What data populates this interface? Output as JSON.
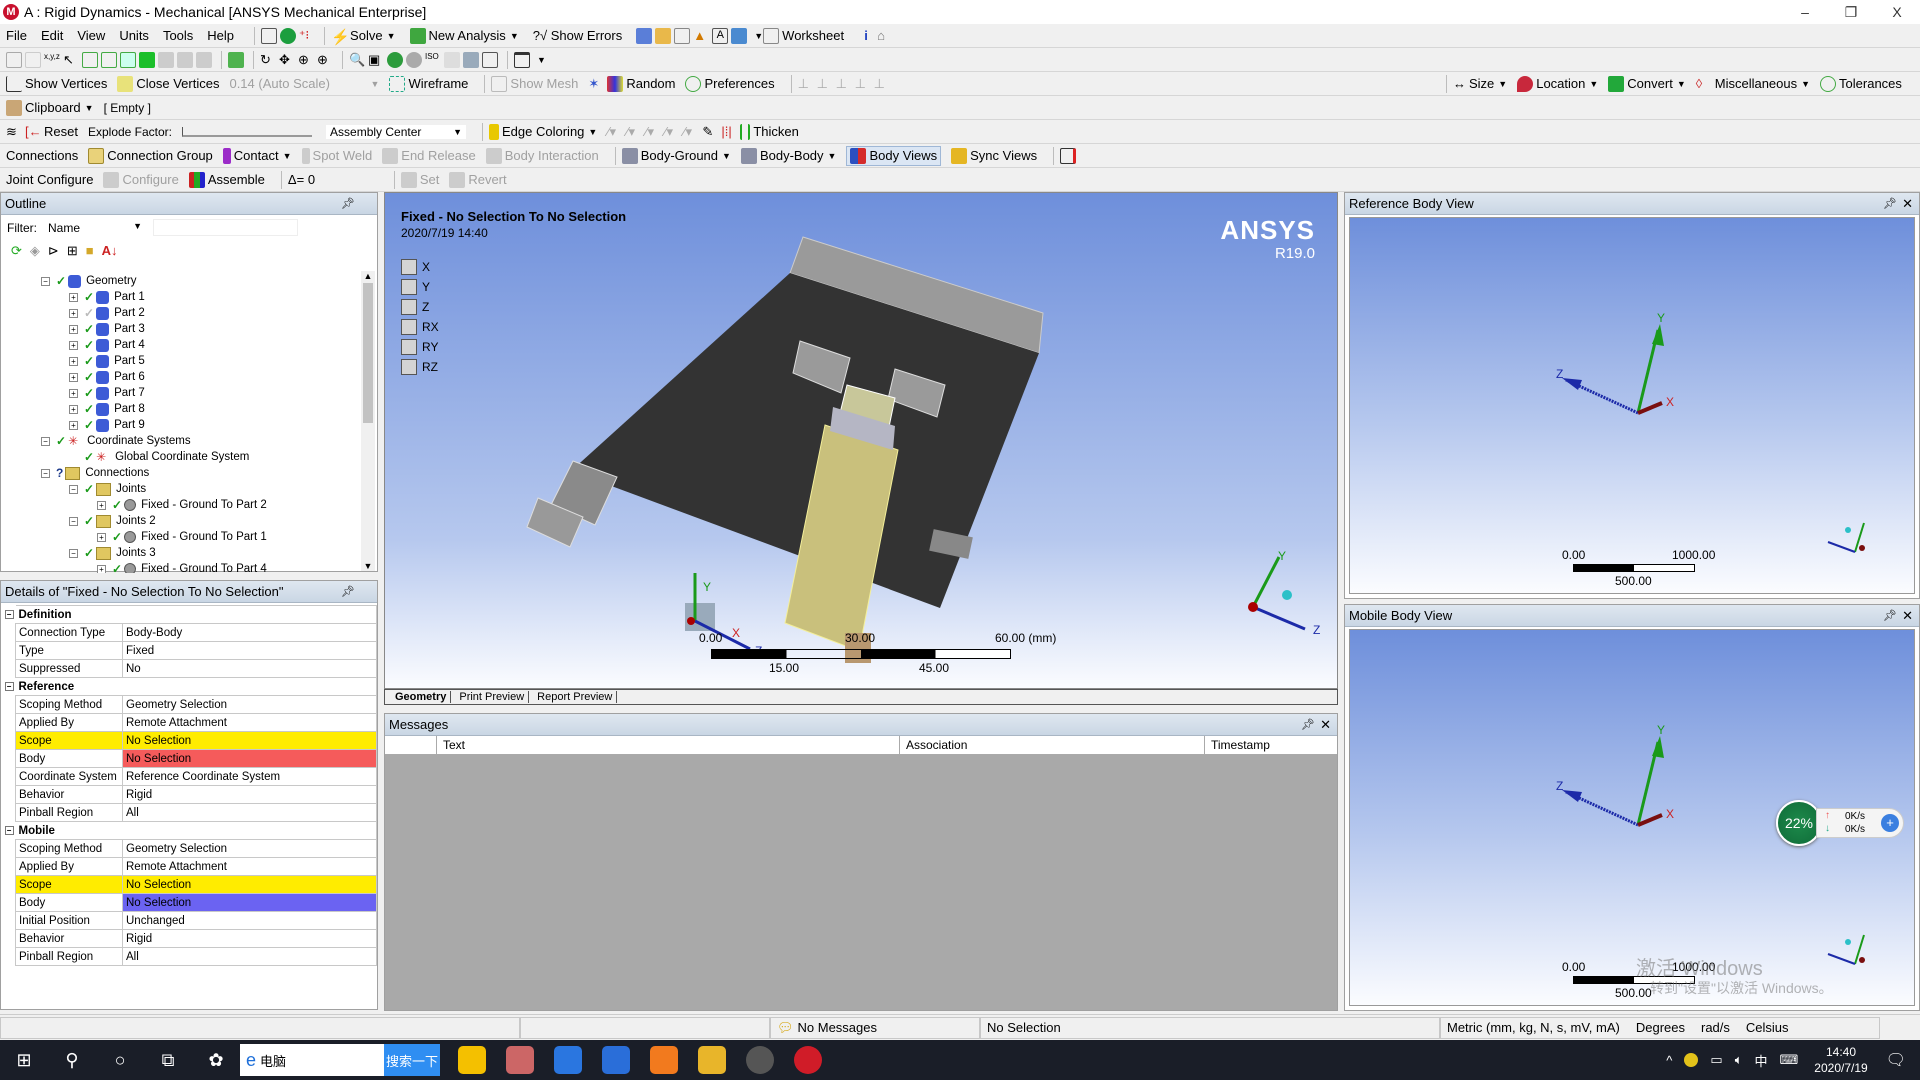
{
  "window": {
    "title": "A : Rigid Dynamics - Mechanical [ANSYS Mechanical Enterprise]",
    "controls": {
      "minimize": "–",
      "restore": "❐",
      "close": "X"
    }
  },
  "menu": [
    "File",
    "Edit",
    "View",
    "Units",
    "Tools",
    "Help"
  ],
  "toolbar1": {
    "solve": "Solve",
    "new_analysis": "New Analysis",
    "show_errors": "?√ Show Errors",
    "worksheet": "Worksheet"
  },
  "toolbar3": {
    "show_vertices": "Show Vertices",
    "close_vertices": "Close Vertices",
    "scale": "0.14 (Auto Scale)",
    "wireframe": "Wireframe",
    "show_mesh": "Show Mesh",
    "random": "Random",
    "preferences": "Preferences",
    "size": "Size",
    "location": "Location",
    "convert": "Convert",
    "miscellaneous": "Miscellaneous",
    "tolerances": "Tolerances"
  },
  "toolbar4": {
    "clipboard": "Clipboard",
    "clipboard_value": "[ Empty ]"
  },
  "toolbar5": {
    "reset": "Reset",
    "explode_factor": "Explode Factor:",
    "explode_value": 0,
    "assembly_center": "Assembly Center",
    "edge_coloring": "Edge Coloring",
    "thicken": "Thicken"
  },
  "toolbar6": {
    "connections": "Connections",
    "connection_group": "Connection Group",
    "contact": "Contact",
    "spot_weld": "Spot Weld",
    "end_release": "End Release",
    "body_interaction": "Body Interaction",
    "body_ground": "Body-Ground",
    "body_body": "Body-Body",
    "body_views": "Body Views",
    "sync_views": "Sync Views"
  },
  "toolbar7": {
    "joint_configure": "Joint Configure",
    "configure": "Configure",
    "assemble": "Assemble",
    "delta": "Δ=",
    "delta_value": "0",
    "set": "Set",
    "revert": "Revert"
  },
  "outline": {
    "title": "Outline",
    "filter_label": "Filter:",
    "filter_value": "Name",
    "filter_text": "",
    "tree": [
      {
        "label": "Geometry",
        "level": 0,
        "status": "ok",
        "icon": "geometry"
      },
      {
        "label": "Part 1",
        "level": 1,
        "status": "ok",
        "icon": "part"
      },
      {
        "label": "Part 2",
        "level": 1,
        "status": "suppressed",
        "icon": "part"
      },
      {
        "label": "Part 3",
        "level": 1,
        "status": "ok",
        "icon": "part"
      },
      {
        "label": "Part 4",
        "level": 1,
        "status": "ok",
        "icon": "part"
      },
      {
        "label": "Part 5",
        "level": 1,
        "status": "ok",
        "icon": "part"
      },
      {
        "label": "Part 6",
        "level": 1,
        "status": "ok",
        "icon": "part"
      },
      {
        "label": "Part 7",
        "level": 1,
        "status": "ok",
        "icon": "part"
      },
      {
        "label": "Part 8",
        "level": 1,
        "status": "ok",
        "icon": "part"
      },
      {
        "label": "Part 9",
        "level": 1,
        "status": "ok",
        "icon": "part"
      },
      {
        "label": "Coordinate Systems",
        "level": 0,
        "status": "ok",
        "icon": "csys"
      },
      {
        "label": "Global Coordinate System",
        "level": 1,
        "status": "ok",
        "icon": "csys"
      },
      {
        "label": "Connections",
        "level": 0,
        "status": "question",
        "icon": "connections"
      },
      {
        "label": "Joints",
        "level": 1,
        "status": "ok",
        "icon": "folder"
      },
      {
        "label": "Fixed - Ground To Part 2",
        "level": 2,
        "status": "ok",
        "icon": "joint"
      },
      {
        "label": "Joints 2",
        "level": 1,
        "status": "ok",
        "icon": "folder"
      },
      {
        "label": "Fixed - Ground To Part 1",
        "level": 2,
        "status": "ok",
        "icon": "joint"
      },
      {
        "label": "Joints 3",
        "level": 1,
        "status": "ok",
        "icon": "folder"
      },
      {
        "label": "Fixed - Ground To Part 4",
        "level": 2,
        "status": "ok",
        "icon": "joint"
      }
    ]
  },
  "details": {
    "title": "Details of \"Fixed - No Selection To No Selection\"",
    "sections": [
      {
        "name": "Definition",
        "rows": [
          [
            "Connection Type",
            "Body-Body",
            ""
          ],
          [
            "Type",
            "Fixed",
            ""
          ],
          [
            "Suppressed",
            "No",
            ""
          ]
        ]
      },
      {
        "name": "Reference",
        "rows": [
          [
            "Scoping Method",
            "Geometry Selection",
            ""
          ],
          [
            "Applied By",
            "Remote Attachment",
            ""
          ],
          [
            "Scope",
            "No Selection",
            "yellow"
          ],
          [
            "Body",
            "No Selection",
            "red"
          ],
          [
            "Coordinate System",
            "Reference Coordinate System",
            ""
          ],
          [
            "Behavior",
            "Rigid",
            ""
          ],
          [
            "Pinball Region",
            "All",
            ""
          ]
        ]
      },
      {
        "name": "Mobile",
        "rows": [
          [
            "Scoping Method",
            "Geometry Selection",
            ""
          ],
          [
            "Applied By",
            "Remote Attachment",
            ""
          ],
          [
            "Scope",
            "No Selection",
            "yellow"
          ],
          [
            "Body",
            "No Selection",
            "blue"
          ],
          [
            "Initial Position",
            "Unchanged",
            ""
          ],
          [
            "Behavior",
            "Rigid",
            ""
          ],
          [
            "Pinball Region",
            "All",
            ""
          ]
        ]
      }
    ]
  },
  "viewport": {
    "heading": "Fixed - No Selection To No Selection",
    "timestamp": "2020/7/19 14:40",
    "brand": "ANSYS",
    "version": "R19.0",
    "dofs": [
      "X",
      "Y",
      "Z",
      "RX",
      "RY",
      "RZ"
    ],
    "scale": {
      "top": [
        "0.00",
        "30.00",
        "60.00 (mm)"
      ],
      "bottom": [
        "15.00",
        "45.00"
      ]
    },
    "axes": {
      "x": "X",
      "y": "Y",
      "z": "Z"
    },
    "tabs": [
      "Geometry",
      "Print Preview",
      "Report Preview"
    ]
  },
  "messages": {
    "title": "Messages",
    "columns": [
      "",
      "Text",
      "Association",
      "Timestamp"
    ]
  },
  "ref_view": {
    "title": "Reference Body View",
    "scale": {
      "left": "0.00",
      "right": "1000.00",
      "mid": "500.00"
    }
  },
  "mob_view": {
    "title": "Mobile Body View",
    "scale": {
      "left": "0.00",
      "right": "1000.00",
      "mid": "500.00"
    }
  },
  "net_widget": {
    "percent": "22%",
    "up": "0K/s",
    "down": "0K/s"
  },
  "watermark": {
    "line1": "激活 Windows",
    "line2": "转到\"设置\"以激活 Windows。"
  },
  "status": {
    "messages": "No Messages",
    "selection": "No Selection",
    "units": "Metric (mm, kg, N, s, mV, mA)",
    "angle": "Degrees",
    "rot": "rad/s",
    "temp": "Celsius"
  },
  "taskbar": {
    "search_text": "电脑",
    "search_button": "搜索一下",
    "time": "14:40",
    "date": "2020/7/19",
    "ime": "中"
  },
  "colors": {
    "viewport_top": "#6e8fdb",
    "scope_yellow": "#ffec00",
    "body_red": "#f55b5b",
    "body_blue": "#6b63f2",
    "tree_check": "#1a9a1a"
  }
}
